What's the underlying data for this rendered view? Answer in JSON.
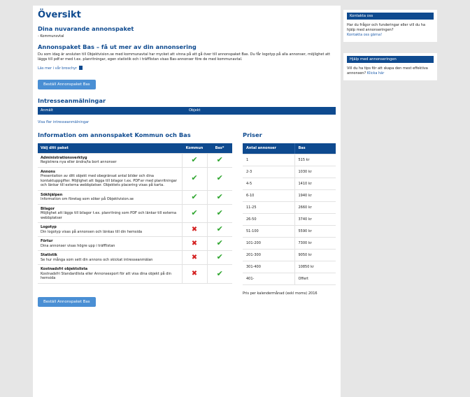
{
  "main": {
    "title": "Översikt",
    "current": {
      "heading": "Dina nuvarande annonspaket",
      "item": "- Kommunsvtal"
    },
    "promo": {
      "heading": "Annonspaket Bas – få ut mer av din annonsering",
      "text": "Du som idag är ansluten till Objektvision.se med kommunavtal har mycket att vinna på att gå över till annonspaket Bas. Du får logotyp på alla annonser, möjlighet att läggs till pdf:er med t.ex. planritningar, egen statistik och i träfflistan visas Bas-annonser före de med kommunavtal.",
      "brochure_link": "Läs mer i vår broschyr",
      "button": "Beställ Annonspaket Bas"
    },
    "interest": {
      "heading": "Intresseanmälningar",
      "col_received": "Anmält",
      "col_object": "Objekt",
      "more_link": "Visa fler intresseanmälningar"
    },
    "packages": {
      "heading": "Information om annonspaket Kommun och Bas",
      "col_package": "Välj ditt paket",
      "col_kommun": "Kommun",
      "col_bas": "Bas*",
      "rows": [
        {
          "name": "Administrationsverktyg",
          "desc": "Registrera nya eller ändra/ta bort annonser",
          "kommun": true,
          "bas": true
        },
        {
          "name": "Annons",
          "desc": "Presentation av ditt objekt med obegränsat antal bilder och dina kontaktuppgifter. Möjlighet att lägga till bilagor t.ex. PDF:er med planritningar och länkar till externa webbplatser. Objektets placering visas på karta.",
          "kommun": true,
          "bas": true
        },
        {
          "name": "Sökhjälpen",
          "desc": "Information om företag som söker på Objektvision.se",
          "kommun": true,
          "bas": true
        },
        {
          "name": "Bilagor",
          "desc": "Möjlighet att läggs till bilagor t.ex. planritning som PDF och länkar till externa webbplatser",
          "kommun": true,
          "bas": true
        },
        {
          "name": "Logotyp",
          "desc": "Din logotyp visas på annonsen och länkas till din hemsida",
          "kommun": false,
          "bas": true
        },
        {
          "name": "Förtur",
          "desc": "Dina annonser visas högre upp i träfflistan",
          "kommun": false,
          "bas": true
        },
        {
          "name": "Statistik",
          "desc": "Se hur många som sett din annons och skickat intresseanmälan",
          "kommun": false,
          "bas": true
        },
        {
          "name": "Kostnadsfri objektslista",
          "desc": "Kostnadsfri Standardlista eller Annonsexport för att visa dina objekt på din hemsida",
          "kommun": false,
          "bas": true
        }
      ],
      "button": "Beställ Annonspaket Bas"
    },
    "prices": {
      "heading": "Priser",
      "col_count": "Antal annonser",
      "col_bas": "Bas",
      "rows": [
        {
          "count": "1",
          "price": "515 kr"
        },
        {
          "count": "2-3",
          "price": "1030 kr"
        },
        {
          "count": "4-5",
          "price": "1410 kr"
        },
        {
          "count": "6-10",
          "price": "1940 kr"
        },
        {
          "count": "11-25",
          "price": "2660 kr"
        },
        {
          "count": "26-50",
          "price": "3740 kr"
        },
        {
          "count": "51-100",
          "price": "5590 kr"
        },
        {
          "count": "101-200",
          "price": "7300 kr"
        },
        {
          "count": "201-300",
          "price": "9050 kr"
        },
        {
          "count": "301-400",
          "price": "10850 kr"
        },
        {
          "count": "401-",
          "price": "Offert"
        }
      ],
      "note": "Pris per kalendermånad (exkl moms) 2016"
    }
  },
  "sidebar": {
    "contact": {
      "title": "Kontakta oss",
      "text": "Har du frågor och funderingar eller vill du ha hjälp med annonseringen?",
      "link": "Kontakta oss gärna!"
    },
    "help": {
      "title": "Hjälp med annonseringen",
      "text": "Vill du ha tips för att skapa den mest effektiva annonsen?",
      "link": "Klicka här"
    }
  },
  "colors": {
    "brand": "#0e4a8f",
    "button": "#4a8fd4",
    "check": "#2da52d",
    "cross": "#d42222"
  },
  "icons": {
    "check": "check-icon",
    "cross": "cross-icon",
    "pdf": "document-icon"
  }
}
